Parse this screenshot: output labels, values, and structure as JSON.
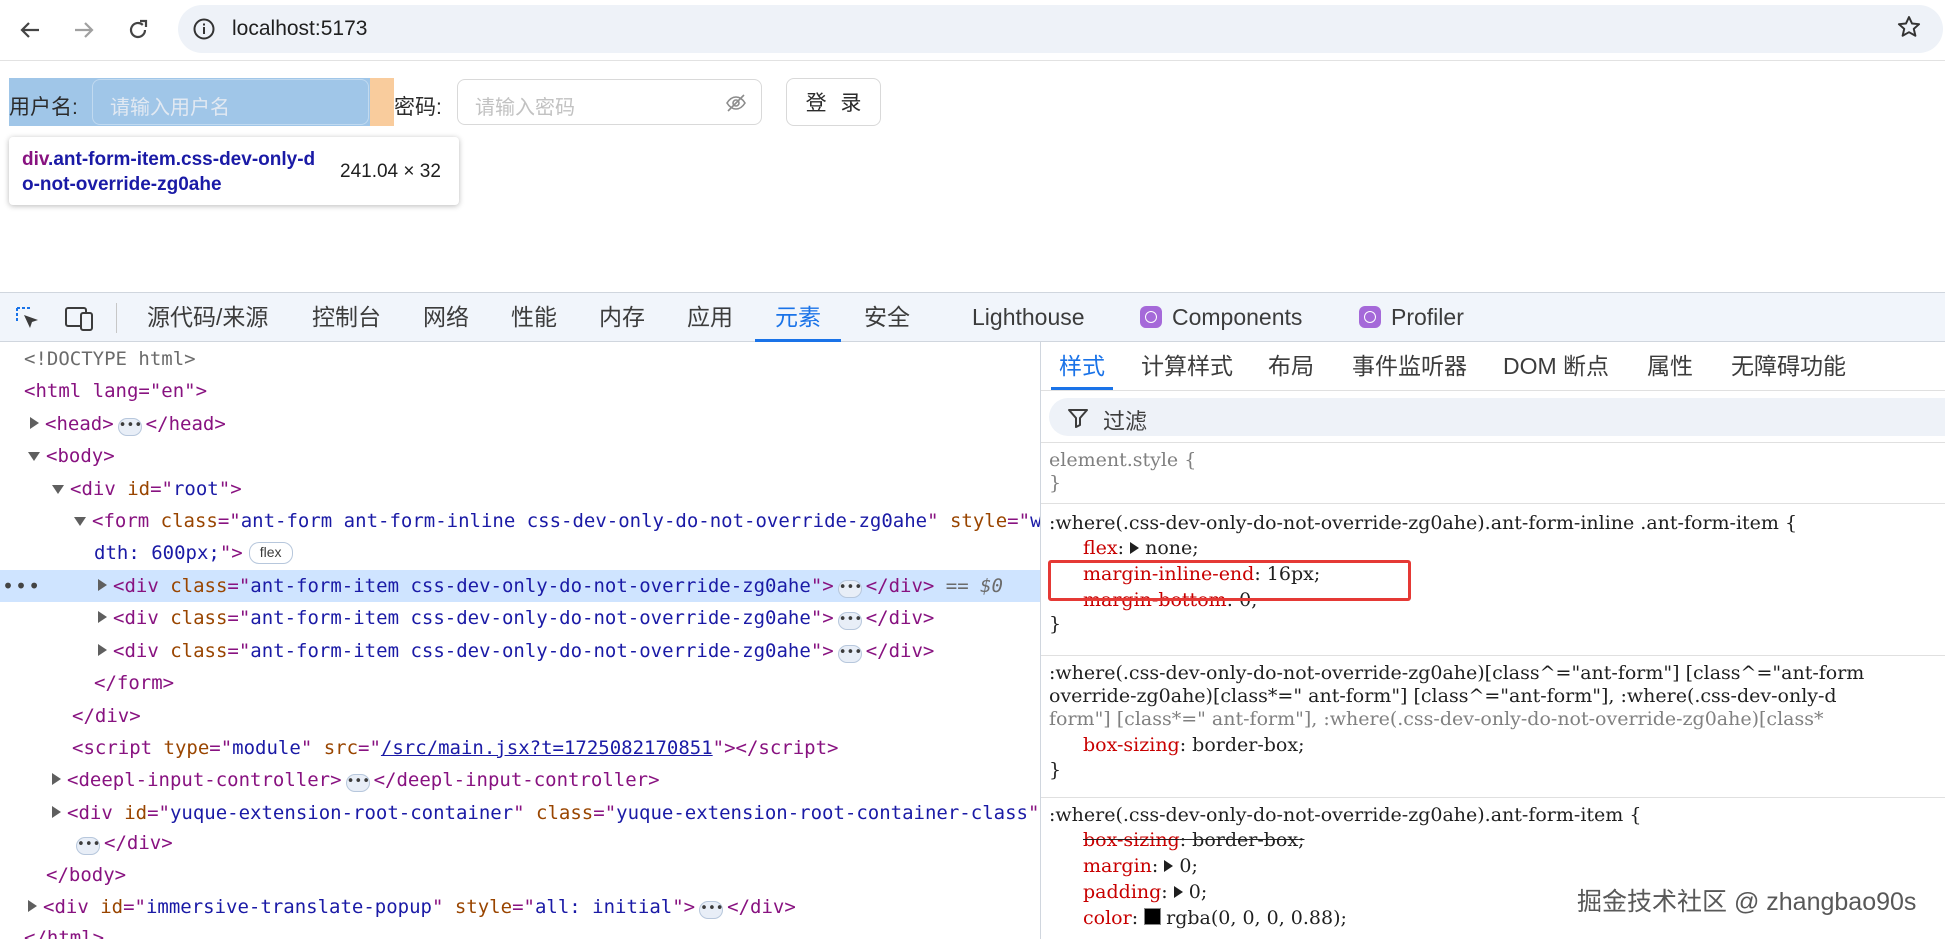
{
  "browser": {
    "url": "localhost:5173"
  },
  "form": {
    "username_label": "用户名:",
    "username_placeholder": "请输入用户名",
    "password_label": "密码:",
    "password_placeholder": "请输入密码",
    "login_button": "登 录"
  },
  "inspector_tooltip": {
    "tag": "div",
    "classes": ".ant-form-item.css-dev-only-do-not-override-zg0ahe",
    "dimensions": "241.04 × 32"
  },
  "devtools": {
    "tabs": [
      "源代码/来源",
      "控制台",
      "网络",
      "性能",
      "内存",
      "应用",
      "元素",
      "安全",
      "Lighthouse",
      "Components",
      "Profiler"
    ],
    "active_tab": "元素",
    "styles_tabs": [
      "样式",
      "计算样式",
      "布局",
      "事件监听器",
      "DOM 断点",
      "属性",
      "无障碍功能"
    ],
    "active_styles_tab": "样式",
    "filter_label": "过滤",
    "dom": {
      "doctype": "<!DOCTYPE html>",
      "html_open": "<html lang=\"en\">",
      "head": "head",
      "body": "body",
      "root_div": "root",
      "form_class": "ant-form ant-form-inline css-dev-only-do-not-override-zg0ahe",
      "form_style_a": "wi",
      "form_style_b": "dth: 600px;",
      "flex_badge": "flex",
      "item_class": "ant-form-item css-dev-only-do-not-override-zg0ahe",
      "selected_marker": "== $0",
      "script_type": "module",
      "script_src": "/src/main.jsx?t=1725082170851",
      "deepl_tag": "deepl-input-controller",
      "yuque_id": "yuque-extension-root-container",
      "yuque_class": "yuque-extension-root-container-class",
      "immersive_id": "immersive-translate-popup",
      "immersive_style": "all: initial",
      "html_close": "</html>"
    },
    "styles": {
      "element_style": "element.style {",
      "rule1_selector": ":where(.css-dev-only-do-not-override-zg0ahe).ant-form-inline .ant-form-item {",
      "rule1_props": [
        {
          "name": "flex",
          "value": "none"
        },
        {
          "name": "margin-inline-end",
          "value": "16px"
        },
        {
          "name": "margin-bottom",
          "value": "0"
        }
      ],
      "rule2_line1": ":where(.css-dev-only-do-not-override-zg0ahe)[class^=\"ant-form\"] [class^=\"ant-form",
      "rule2_line2": "override-zg0ahe)[class*=\" ant-form\"] [class^=\"ant-form\"], :where(.css-dev-only-d",
      "rule2_line3": "form\"] [class*=\" ant-form\"], :where(.css-dev-only-do-not-override-zg0ahe)[class*",
      "rule2_props": [
        {
          "name": "box-sizing",
          "value": "border-box"
        }
      ],
      "rule3_selector": ":where(.css-dev-only-do-not-override-zg0ahe).ant-form-item {",
      "rule3_props": [
        {
          "name": "box-sizing",
          "value": "border-box"
        },
        {
          "name": "margin",
          "value": "0"
        },
        {
          "name": "padding",
          "value": "0"
        },
        {
          "name": "color",
          "value": "rgba(0, 0, 0, 0.88)"
        }
      ]
    }
  },
  "watermark": "掘金技术社区 @ zhangbao90s"
}
